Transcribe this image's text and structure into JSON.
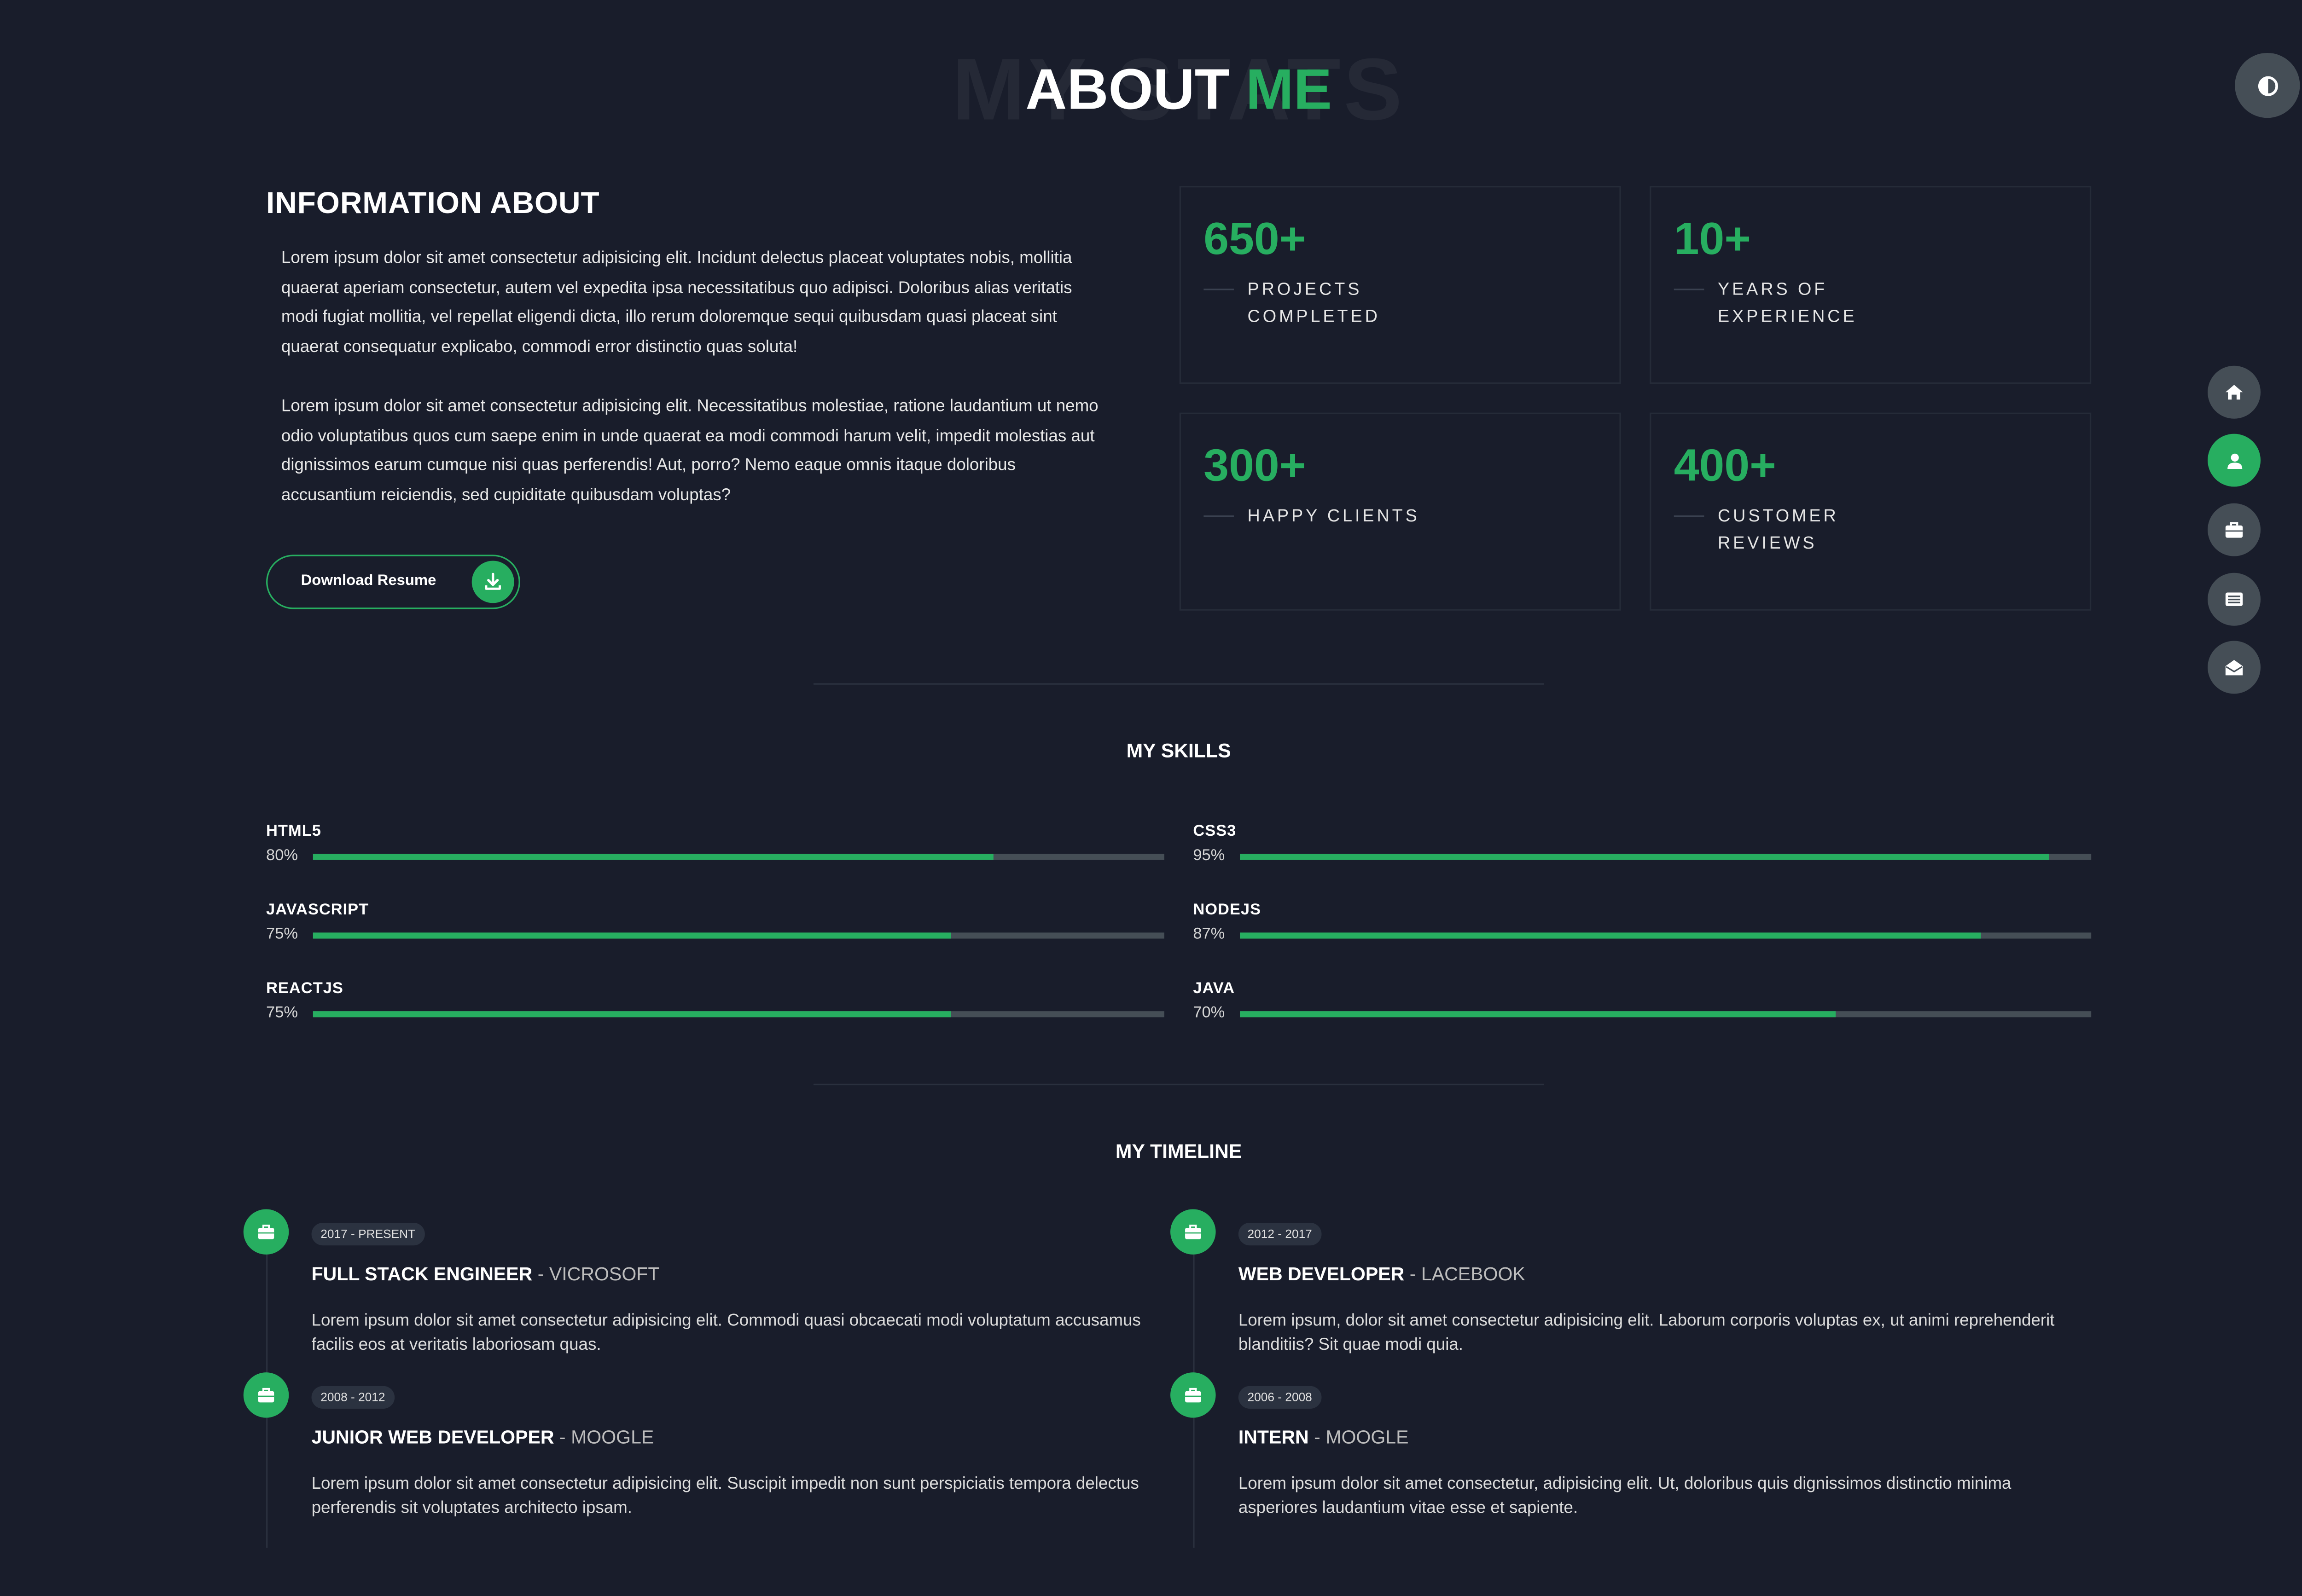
{
  "header": {
    "background_word": "MY STATS",
    "title_part1": "ABOUT",
    "title_part2": "ME"
  },
  "theme_toggle": {
    "icon": "contrast-icon"
  },
  "info": {
    "title": "INFORMATION ABOUT",
    "paragraphs": [
      "Lorem ipsum dolor sit amet consectetur adipisicing elit. Incidunt delectus placeat voluptates nobis, mollitia quaerat aperiam consectetur, autem vel expedita ipsa necessitatibus quo adipisci. Doloribus alias veritatis modi fugiat mollitia, vel repellat eligendi dicta, illo rerum doloremque sequi quibusdam quasi placeat sint quaerat consequatur explicabo, commodi error distinctio quas soluta!",
      "Lorem ipsum dolor sit amet consectetur adipisicing elit. Necessitatibus molestiae, ratione laudantium ut nemo odio voluptatibus quos cum saepe enim in unde quaerat ea modi commodi harum velit, impedit molestias aut dignissimos earum cumque nisi quas perferendis! Aut, porro? Nemo eaque omnis itaque doloribus accusantium reiciendis, sed cupiditate quibusdam voluptas?"
    ],
    "download_label": "Download Resume",
    "download_icon": "download-icon"
  },
  "stats": [
    {
      "value": "650+",
      "label": "PROJECTS COMPLETED"
    },
    {
      "value": "10+",
      "label": "YEARS OF EXPERIENCE"
    },
    {
      "value": "300+",
      "label": "HAPPY CLIENTS"
    },
    {
      "value": "400+",
      "label": "CUSTOMER REVIEWS"
    }
  ],
  "skills": {
    "title": "MY SKILLS",
    "items": [
      {
        "name": "HTML5",
        "percent_label": "80%",
        "level": 80
      },
      {
        "name": "CSS3",
        "percent_label": "95%",
        "level": 95
      },
      {
        "name": "JAVASCRIPT",
        "percent_label": "75%",
        "level": 75
      },
      {
        "name": "NODEJS",
        "percent_label": "87%",
        "level": 87
      },
      {
        "name": "REACTJS",
        "percent_label": "75%",
        "level": 75
      },
      {
        "name": "JAVA",
        "percent_label": "70%",
        "level": 70
      }
    ]
  },
  "side_nav": [
    {
      "icon": "home-icon",
      "active": false
    },
    {
      "icon": "user-icon",
      "active": true
    },
    {
      "icon": "briefcase-icon",
      "active": false
    },
    {
      "icon": "newspaper-icon",
      "active": false
    },
    {
      "icon": "envelope-open-icon",
      "active": false
    }
  ],
  "timeline": {
    "title": "MY TIMELINE",
    "items": [
      {
        "period": "2017 - PRESENT",
        "role": "FULL STACK ENGINEER",
        "separator": "-",
        "company": "VICROSOFT",
        "description": "Lorem ipsum dolor sit amet consectetur adipisicing elit. Commodi quasi obcaecati modi voluptatum accusamus facilis eos at veritatis laboriosam quas."
      },
      {
        "period": "2012 - 2017",
        "role": "WEB DEVELOPER",
        "separator": "-",
        "company": "LACEBOOK",
        "description": "Lorem ipsum, dolor sit amet consectetur adipisicing elit. Laborum corporis voluptas ex, ut animi reprehenderit blanditiis? Sit quae modi quia."
      },
      {
        "period": "2008 - 2012",
        "role": "JUNIOR WEB DEVELOPER",
        "separator": "-",
        "company": "MOOGLE",
        "description": "Lorem ipsum dolor sit amet consectetur adipisicing elit. Suscipit impedit non sunt perspiciatis tempora delectus perferendis sit voluptates architecto ipsam."
      },
      {
        "period": "2006 - 2008",
        "role": "INTERN",
        "separator": "-",
        "company": "MOOGLE",
        "description": "Lorem ipsum dolor sit amet consectetur, adipisicing elit. Ut, doloribus quis dignissimos distinctio minima asperiores laudantium vitae esse et sapiente."
      }
    ]
  },
  "colors": {
    "background": "#191d2b",
    "accent": "#27ae60",
    "muted": "#454e56"
  }
}
